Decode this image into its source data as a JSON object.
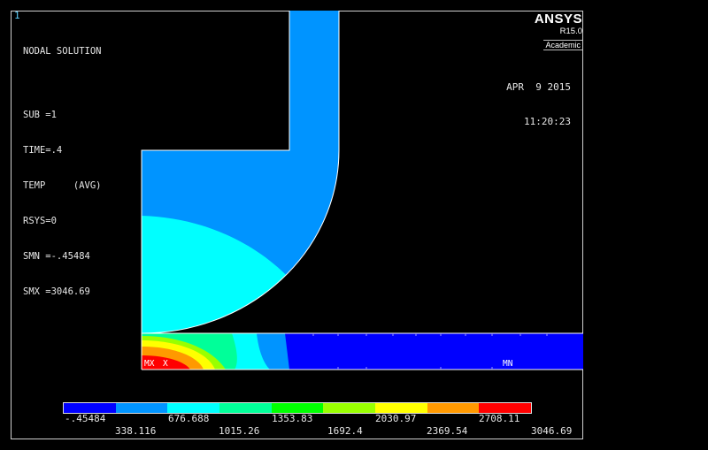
{
  "window_number": "1",
  "info": {
    "title": "NODAL SOLUTION",
    "sub": "SUB =1",
    "time": "TIME=.4",
    "temp": "TEMP     (AVG)",
    "rsys": "RSYS=0",
    "smn": "SMN =-.45484",
    "smx": "SMX =3046.69"
  },
  "brand": {
    "name": "ANSYS",
    "release": "R15.0",
    "edition": "Academic"
  },
  "stamp": {
    "date": "APR  9 2015",
    "time": "11:20:23"
  },
  "markers": {
    "mx": "MX",
    "x": "X",
    "mn": "MN"
  },
  "legend": {
    "colors": [
      "#0000ff",
      "#0094ff",
      "#00ffff",
      "#00ff99",
      "#00ff00",
      "#99ff00",
      "#ffff00",
      "#ff9900",
      "#ff0000"
    ],
    "upper_labels": [
      "-.45484",
      "676.688",
      "1353.83",
      "2030.97",
      "2708.11"
    ],
    "lower_labels": [
      "338.116",
      "1015.26",
      "1692.4",
      "2369.54",
      "3046.69"
    ]
  }
}
